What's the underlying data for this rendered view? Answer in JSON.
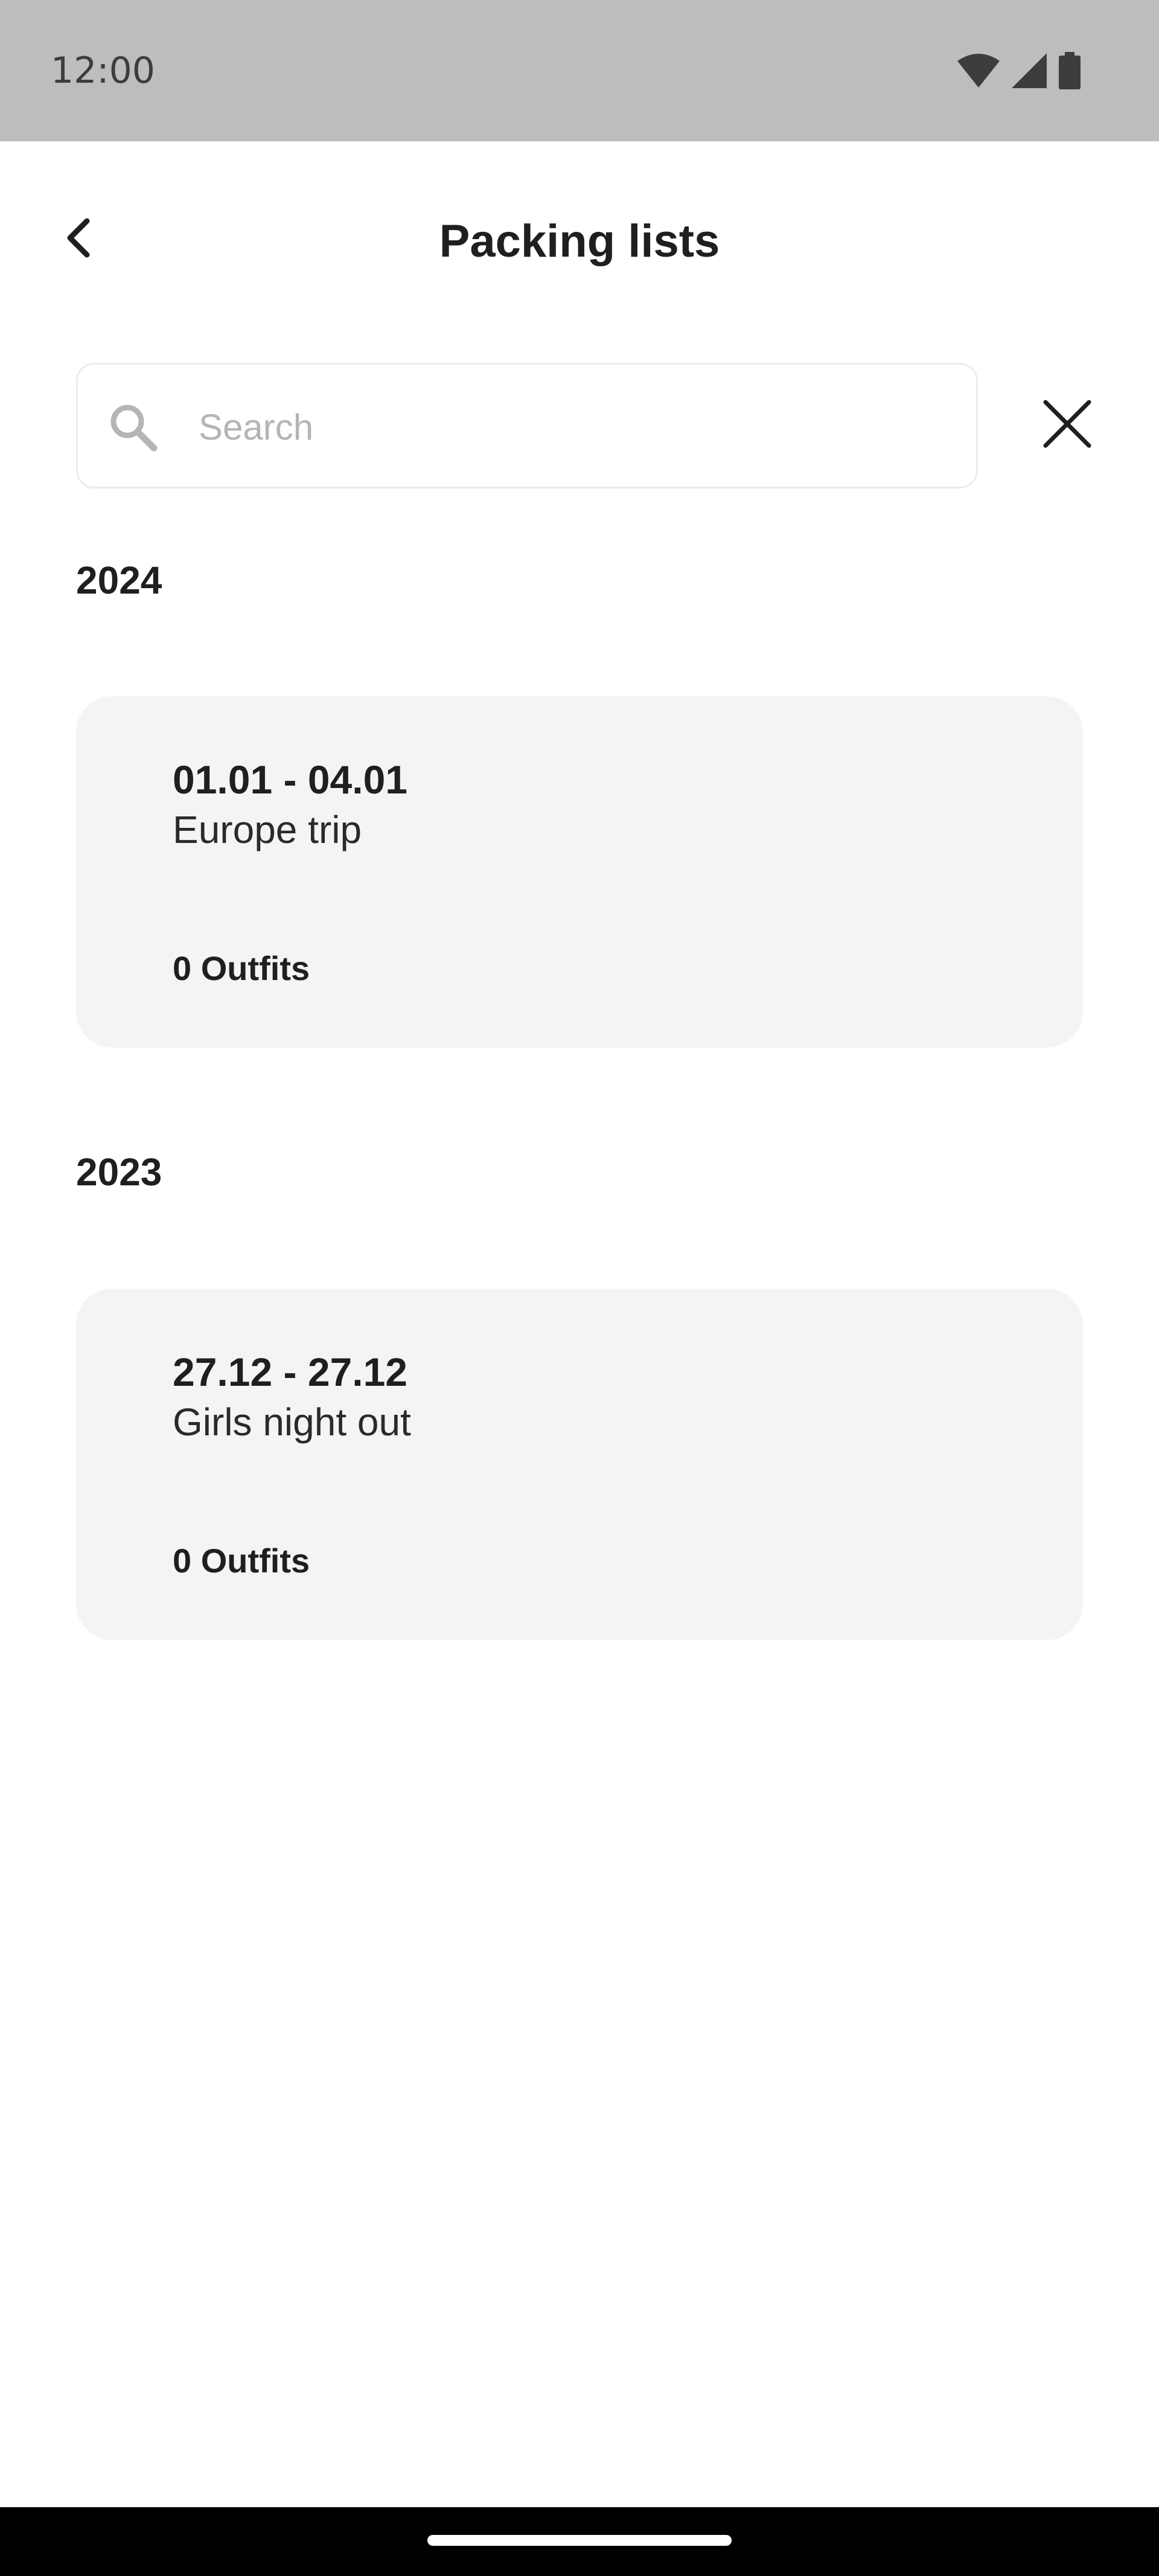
{
  "status_bar": {
    "time": "12:00",
    "icons": [
      "wifi-icon",
      "cell-signal-icon",
      "battery-icon"
    ]
  },
  "header": {
    "title": "Packing lists",
    "back_icon": "chevron-left-icon"
  },
  "search": {
    "placeholder": "Search",
    "value": "",
    "icon": "search-icon",
    "clear_icon": "close-icon"
  },
  "groups": [
    {
      "year": "2024",
      "trips": [
        {
          "dates": "01.01 - 04.01",
          "name": "Europe trip",
          "outfits": "0 Outfits"
        }
      ]
    },
    {
      "year": "2023",
      "trips": [
        {
          "dates": "27.12 - 27.12",
          "name": "Girls night out",
          "outfits": "0 Outfits"
        }
      ]
    }
  ],
  "colors": {
    "status_bar": "#bdbdbd",
    "card_background": "#f4f4f4",
    "text": "#1f1f1f",
    "placeholder": "#b5b5b5"
  }
}
